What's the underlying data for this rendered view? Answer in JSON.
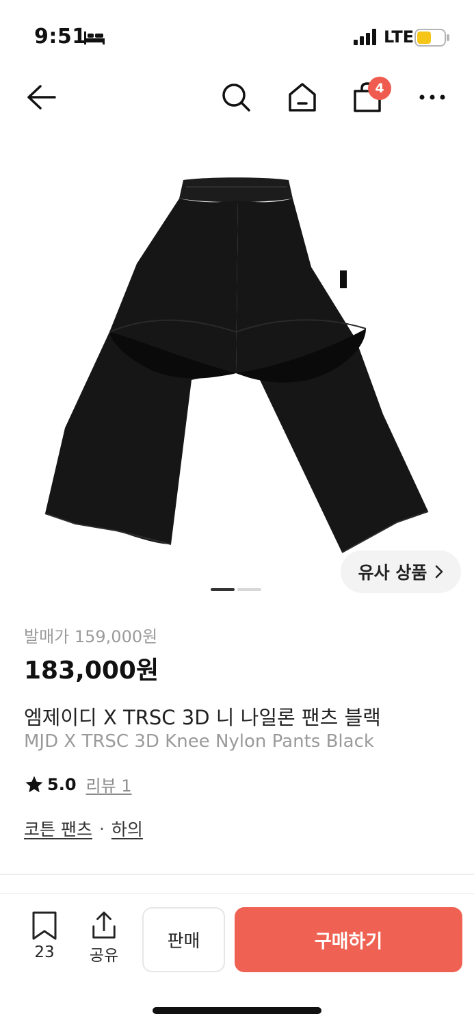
{
  "status_bar": {
    "time": "9:51",
    "network": "LTE",
    "icons": [
      "bed-icon",
      "signal-icon",
      "battery-icon"
    ]
  },
  "nav": {
    "icons": [
      "back-arrow-icon",
      "search-icon",
      "home-icon",
      "shopping-bag-icon",
      "more-icon"
    ],
    "cart_count": "4"
  },
  "product": {
    "image": "black-pants-photo",
    "similar_label": "유사 상품",
    "carousel": {
      "total": 2,
      "active": 1
    },
    "release_price": "발매가 159,000원",
    "price": "183,000원",
    "name_ko": "엠제이디 X TRSC 3D 니 나일론 팬츠 블랙",
    "name_en": "MJD X TRSC 3D Knee Nylon Pants Black",
    "rating": "5.0",
    "review_label": "리뷰 1",
    "categories": [
      "코튼 팬츠",
      "하의"
    ],
    "category_separator": "·"
  },
  "bottom_bar": {
    "bookmark_count": "23",
    "share_label": "공유",
    "sell_label": "판매",
    "buy_label": "구매하기"
  },
  "colors": {
    "accent": "#ef6253",
    "badge": "#ef5b4e",
    "battery": "#f5c518"
  }
}
